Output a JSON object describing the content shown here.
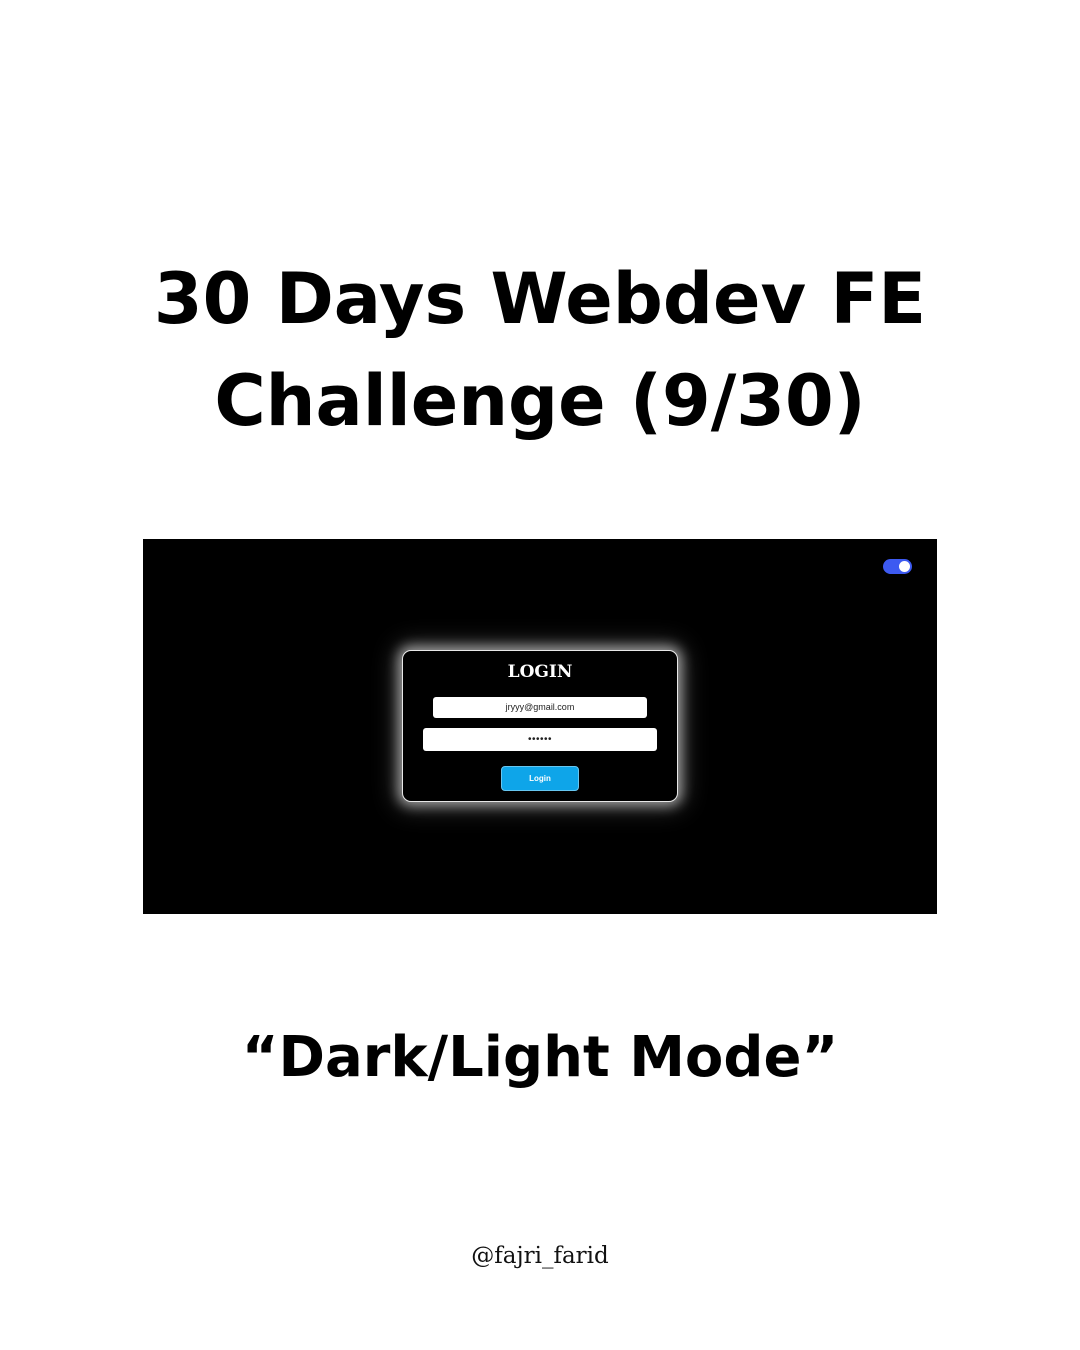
{
  "title": {
    "line1": "30 Days Webdev FE",
    "line2": "Challenge (9/30)"
  },
  "preview": {
    "theme_toggle": {
      "state": "on",
      "track_color": "#3d5af1"
    },
    "login_card": {
      "title": "LOGIN",
      "email_value": "jryyy@gmail.com",
      "password_value": "••••••",
      "button_label": "Login",
      "button_color": "#0ea5e9"
    }
  },
  "subtitle": "“Dark/Light Mode”",
  "handle": "@fajri_farid"
}
